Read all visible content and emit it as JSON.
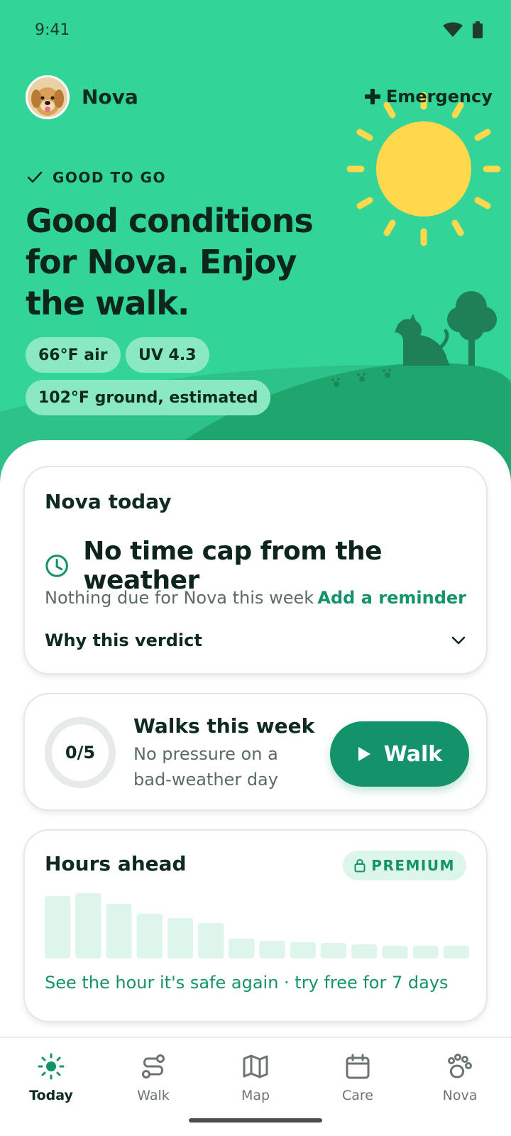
{
  "status_bar": {
    "time": "9:41"
  },
  "header": {
    "pet_name": "Nova",
    "emergency_label": "Emergency"
  },
  "hero": {
    "verdict_label": "GOOD TO GO",
    "headline": "Good conditions for Nova. Enjoy the walk.",
    "chips": {
      "air": "66°F air",
      "uv": "UV 4.3",
      "ground": "102°F ground, estimated"
    }
  },
  "today_card": {
    "title": "Nova today",
    "cap_text": "No time cap from the weather",
    "due_text": "Nothing due for Nova this week",
    "add_reminder": "Add a reminder",
    "why_label": "Why this verdict"
  },
  "walks_card": {
    "progress_label": "0/5",
    "progress_done": 0,
    "progress_total": 5,
    "title": "Walks this week",
    "subtitle": "No pressure on a bad-weather day",
    "walk_button": "Walk"
  },
  "hours_card": {
    "title": "Hours ahead",
    "badge": "PREMIUM",
    "cta": "See the hour it's safe again · try free for 7 days"
  },
  "chart_data": {
    "type": "bar",
    "values": [
      88,
      92,
      77,
      63,
      57,
      50,
      28,
      25,
      23,
      22,
      20,
      18,
      18,
      18
    ],
    "ylim": [
      0,
      100
    ]
  },
  "nav": {
    "items": [
      {
        "label": "Today",
        "icon": "sun-icon",
        "active": true
      },
      {
        "label": "Walk",
        "icon": "route-icon",
        "active": false
      },
      {
        "label": "Map",
        "icon": "map-icon",
        "active": false
      },
      {
        "label": "Care",
        "icon": "calendar-icon",
        "active": false
      },
      {
        "label": "Nova",
        "icon": "paw-icon",
        "active": false
      }
    ]
  },
  "colors": {
    "hero_bg": "#33d497",
    "accent": "#14936a",
    "sun": "#ffd84d",
    "hill": "#1fa66f",
    "chip_bg": "#8ae8c3",
    "bar": "#ddf5ea"
  }
}
